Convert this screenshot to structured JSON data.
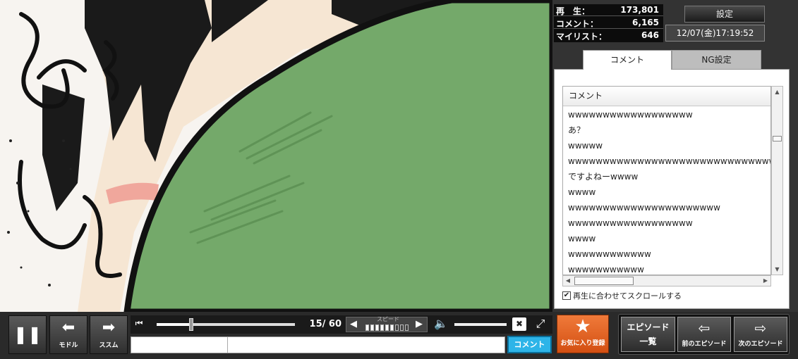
{
  "stats": {
    "play_label": "再　生：",
    "play_value": "173,801",
    "comment_label": "コメント：",
    "comment_value": "6,165",
    "mylist_label": "マイリスト：",
    "mylist_value": "646"
  },
  "settings_label": "設定",
  "datetime": "12/07(金)17:19:52",
  "tabs": {
    "comment": "コメント",
    "ng": "NG設定"
  },
  "comment_list": {
    "header": "コメント",
    "rows": [
      "wwwwwwwwwwwwwwwwww",
      "あ？",
      "wwwww",
      "wwwwwwwwwwwwwwwwwwwwwwwwwwwwwwwww",
      "ですよねーwwww",
      "wwww",
      "wwwwwwwwwwwwwwwwwwwwww",
      "wwwwwwwwwwwwwwwwww",
      "wwww",
      "wwwwwwwwwwww",
      "wwwwwwwwwww"
    ]
  },
  "autoscroll": {
    "checked": "✔",
    "label": "再生に合わせてスクロールする"
  },
  "controls": {
    "pause_icon": "pause-icon",
    "back_label": "モドル",
    "forward_label": "ススム",
    "timecode": "15/ 60",
    "seek_progress": 0.25,
    "speed_label": "スピード",
    "speed_level": 6,
    "speed_max": 9,
    "comment_placeholder": "",
    "comment_button": "コメント"
  },
  "favorite_label": "お気に入り登録",
  "episodes": {
    "list_line1": "エピソード",
    "list_line2": "一覧",
    "prev_label": "前のエピソード",
    "next_label": "次のエピソード"
  },
  "colors": {
    "accent_orange": "#e0611f",
    "comment_blue": "#2db4e8",
    "video_green": "#74a96a"
  }
}
